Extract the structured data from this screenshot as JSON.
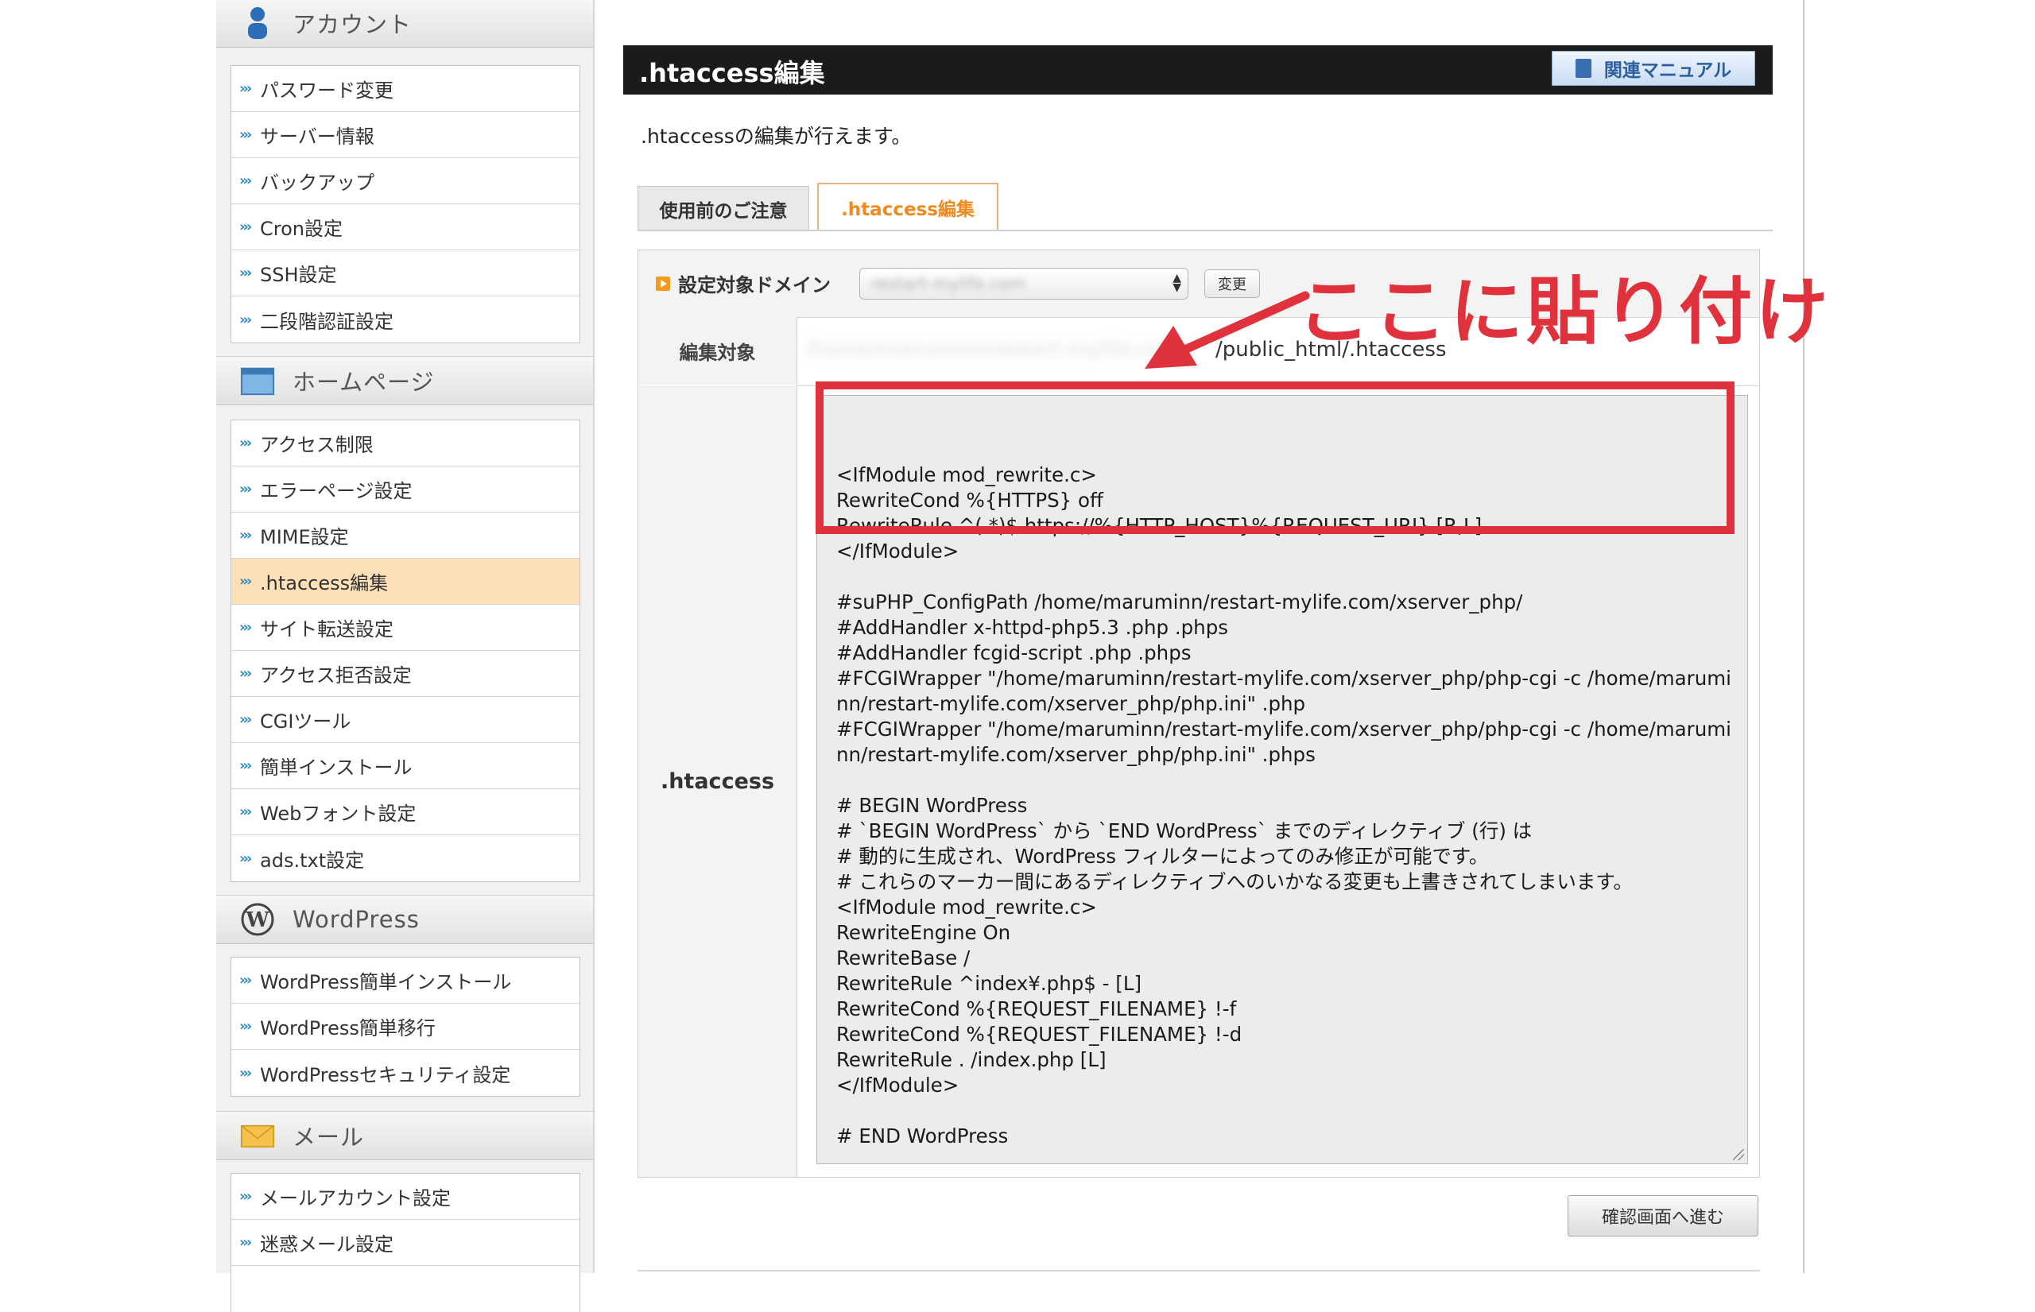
{
  "sidebar": {
    "account": {
      "heading": "アカウント",
      "icon": "user-icon",
      "items": [
        "パスワード変更",
        "サーバー情報",
        "バックアップ",
        "Cron設定",
        "SSH設定",
        "二段階認証設定"
      ]
    },
    "homepage": {
      "heading": "ホームページ",
      "icon": "homepage-icon",
      "items": [
        "アクセス制限",
        "エラーページ設定",
        "MIME設定",
        ".htaccess編集",
        "サイト転送設定",
        "アクセス拒否設定",
        "CGIツール",
        "簡単インストール",
        "Webフォント設定",
        "ads.txt設定"
      ],
      "active_index": 3
    },
    "wordpress": {
      "heading": "WordPress",
      "icon": "wordpress-icon",
      "items": [
        "WordPress簡単インストール",
        "WordPress簡単移行",
        "WordPressセキュリティ設定"
      ]
    },
    "mail": {
      "heading": "メール",
      "icon": "mail-icon",
      "items": [
        "メールアカウント設定",
        "迷惑メール設定"
      ]
    }
  },
  "main": {
    "title": ".htaccess編集",
    "manual_button": "関連マニュアル",
    "description": ".htaccessの編集が行えます。",
    "tabs": [
      ".htaccess編集"
    ],
    "inactive_tab": "使用前のご注意",
    "domain_label": "設定対象ドメイン",
    "domain_value": "restart-mylife.com",
    "change_button": "変更",
    "target_label": "編集対象",
    "target_path": "/public_html/.htaccess",
    "htaccess_label": ".htaccess",
    "confirm_button": "確認画面へ進む"
  },
  "editor": {
    "lines": [
      "<IfModule mod_rewrite.c>",
      "RewriteCond %{HTTPS} off",
      "RewriteRule ^(.*)$ https://%{HTTP_HOST}%{REQUEST_URI} [R,L]",
      "</IfModule>",
      "",
      "#suPHP_ConfigPath /home/maruminn/restart-mylife.com/xserver_php/",
      "#AddHandler x-httpd-php5.3 .php .phps",
      "#AddHandler fcgid-script .php .phps",
      "#FCGIWrapper \"/home/maruminn/restart-mylife.com/xserver_php/php-cgi -c /home/marumi",
      "nn/restart-mylife.com/xserver_php/php.ini\" .php",
      "#FCGIWrapper \"/home/maruminn/restart-mylife.com/xserver_php/php-cgi -c /home/marumi",
      "nn/restart-mylife.com/xserver_php/php.ini\" .phps",
      "",
      "# BEGIN WordPress",
      "# `BEGIN WordPress` から `END WordPress` までのディレクティブ (行) は",
      "# 動的に生成され、WordPress フィルターによってのみ修正が可能です。",
      "# これらのマーカー間にあるディレクティブへのいかなる変更も上書きされてしまいます。",
      "<IfModule mod_rewrite.c>",
      "RewriteEngine On",
      "RewriteBase /",
      "RewriteRule ^index¥.php$ - [L]",
      "RewriteCond %{REQUEST_FILENAME} !-f",
      "RewriteCond %{REQUEST_FILENAME} !-d",
      "RewriteRule . /index.php [L]",
      "</IfModule>",
      "",
      "# END WordPress"
    ]
  },
  "annotation": {
    "callout_text": "ここに貼り付け",
    "color": "#e0323d"
  }
}
